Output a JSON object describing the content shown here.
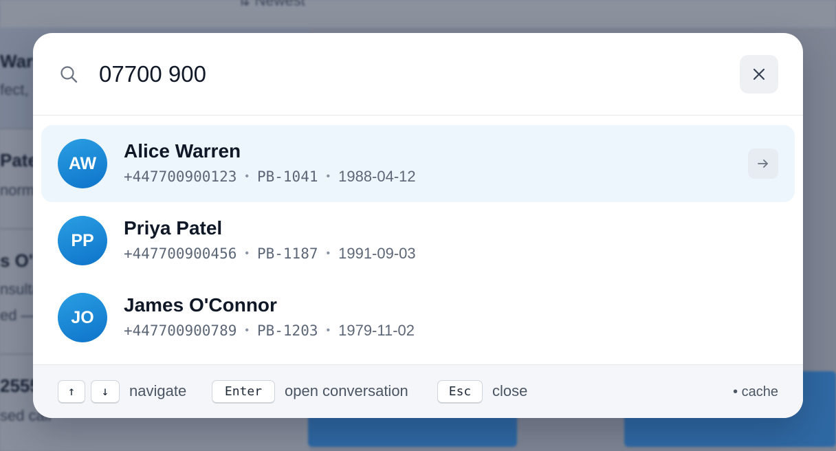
{
  "background": {
    "sort_label": "Newest",
    "rows": [
      {
        "title": "Warr",
        "subtitle": "fect,"
      },
      {
        "title": "Pate",
        "subtitle": "norm"
      },
      {
        "title": "s O'",
        "subtitle": "nsulta",
        "subtitle2": "ed —"
      },
      {
        "title": "2555",
        "subtitle": "sed call"
      }
    ]
  },
  "search": {
    "query": "07700 900",
    "placeholder": "",
    "icon": "search-icon",
    "clear_icon": "close-icon"
  },
  "results": [
    {
      "initials": "AW",
      "name": "Alice Warren",
      "phone": "+447700900123",
      "id": "PB-1041",
      "dob": "1988-04-12",
      "active": true
    },
    {
      "initials": "PP",
      "name": "Priya Patel",
      "phone": "+447700900456",
      "id": "PB-1187",
      "dob": "1991-09-03",
      "active": false
    },
    {
      "initials": "JO",
      "name": "James O'Connor",
      "phone": "+447700900789",
      "id": "PB-1203",
      "dob": "1979-11-02",
      "active": false
    }
  ],
  "separator": "•",
  "footer": {
    "up_key": "↑",
    "down_key": "↓",
    "navigate_label": "navigate",
    "enter_key": "Enter",
    "enter_label": "open conversation",
    "esc_key": "Esc",
    "esc_label": "close",
    "source_label": "• cache"
  },
  "colors": {
    "accent": "#0e73c9",
    "active_row": "#edf5fd"
  }
}
